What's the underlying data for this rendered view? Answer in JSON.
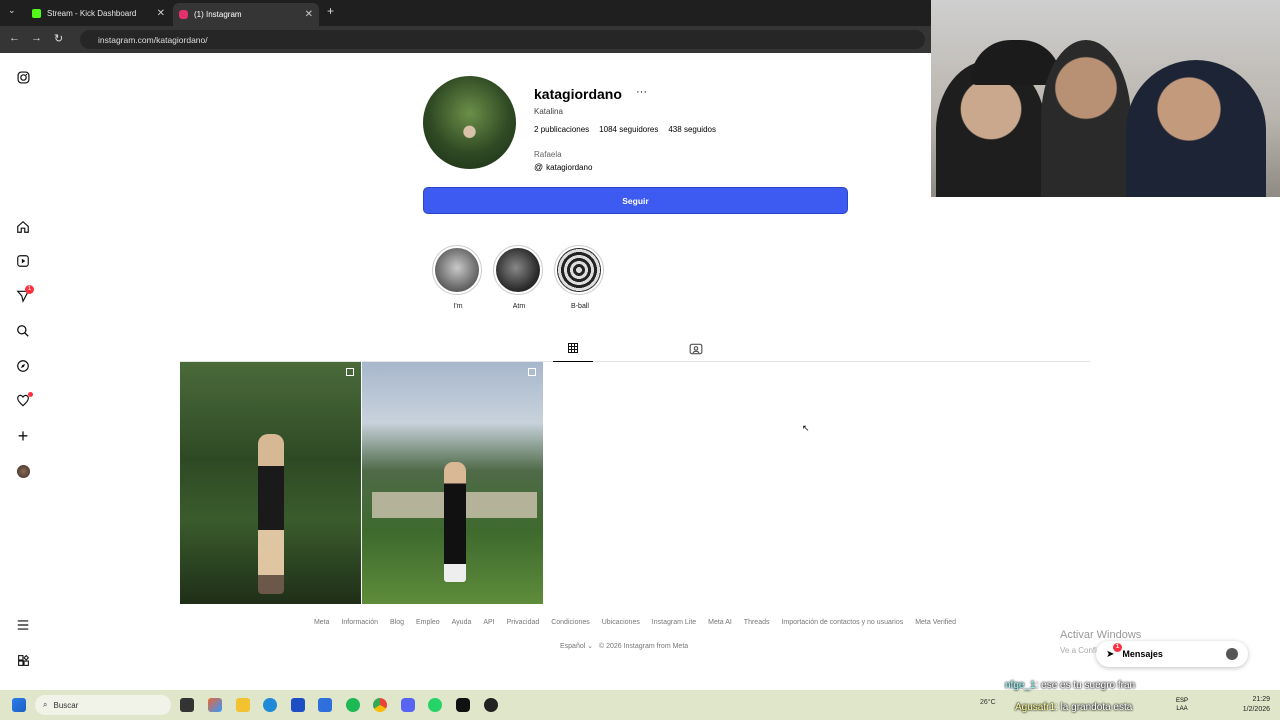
{
  "browser": {
    "tabs": [
      {
        "label": "Stream - Kick Dashboard",
        "favicon_color": "#53fc18"
      },
      {
        "label": "(1) Instagram",
        "favicon_color": "#e1306c"
      }
    ],
    "new_tab": "+",
    "url": "instagram.com/katagiordano/"
  },
  "profile": {
    "username": "katagiordano",
    "more": "···",
    "full_name": "Katalina",
    "stats": {
      "posts": "2",
      "posts_label": "publicaciones",
      "followers": "1084",
      "followers_label": "seguidores",
      "following": "438",
      "following_label": "seguidos"
    },
    "location": "Rafaela",
    "threads_handle": "katagiordano",
    "follow_button": "Seguir"
  },
  "highlights": [
    {
      "label": "I'm"
    },
    {
      "label": "Atm"
    },
    {
      "label": "B-ball"
    }
  ],
  "footer": {
    "links": [
      "Meta",
      "Información",
      "Blog",
      "Empleo",
      "Ayuda",
      "API",
      "Privacidad",
      "Condiciones",
      "Ubicaciones",
      "Instagram Lite",
      "Meta AI",
      "Threads",
      "Importación de contactos y no usuarios",
      "Meta Verified"
    ],
    "language": "Español",
    "copyright": "© 2026 Instagram from Meta"
  },
  "windows": {
    "activate_title": "Activar Windows",
    "activate_sub": "Ve a Configuración para activar Windows.",
    "messages_label": "Mensajes",
    "messages_badge": "1",
    "search_placeholder": "Buscar",
    "lang": "ESP",
    "lang2": "LAA",
    "time": "21:29",
    "date": "1/2/2026",
    "weather": "26°C"
  },
  "chat": [
    {
      "user": "nfge_1",
      "text": ": ese es tu suegro fran"
    },
    {
      "user": "Agusafr1",
      "text": ": la grandota esta"
    }
  ],
  "colors": {
    "follow": "#3d5af1",
    "badge": "#ff3040"
  }
}
